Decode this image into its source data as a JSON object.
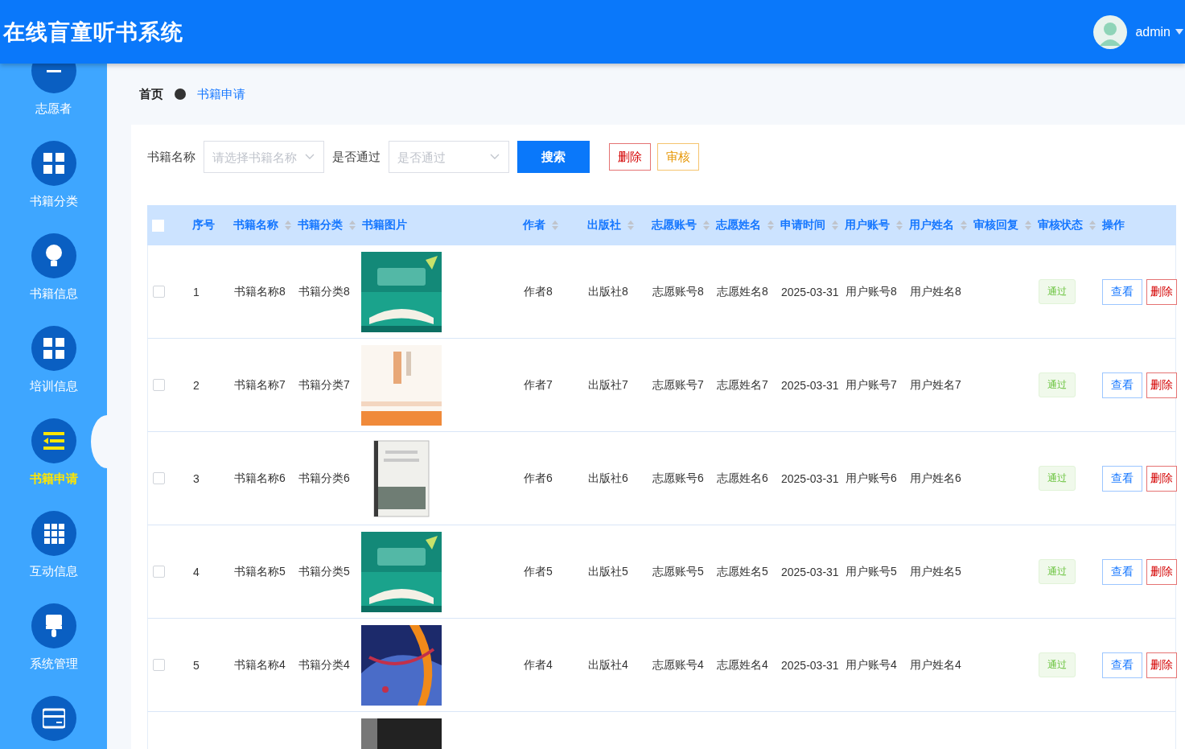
{
  "header": {
    "title": "在线盲童听书系统",
    "user": "admin"
  },
  "sidebar": {
    "items": [
      {
        "label": "志愿者",
        "kind": "minus",
        "selected": false
      },
      {
        "label": "书籍分类",
        "kind": "grid",
        "selected": false
      },
      {
        "label": "书籍信息",
        "kind": "bulb",
        "selected": false
      },
      {
        "label": "培训信息",
        "kind": "grid",
        "selected": false
      },
      {
        "label": "书籍申请",
        "kind": "list",
        "selected": true
      },
      {
        "label": "互动信息",
        "kind": "grid9",
        "selected": false
      },
      {
        "label": "系统管理",
        "kind": "brush",
        "selected": false
      },
      {
        "kind": "card",
        "selected": false
      }
    ]
  },
  "breadcrumb": [
    {
      "label": "首页",
      "current": false
    },
    {
      "label": "书籍申请",
      "current": true
    }
  ],
  "search": {
    "fields": [
      {
        "label": "书籍名称",
        "placeholder": "请选择书籍名称"
      },
      {
        "label": "是否通过",
        "placeholder": "是否通过"
      }
    ],
    "buttons": [
      {
        "label": "搜索",
        "kind": "primary"
      },
      {
        "label": "删除",
        "kind": "danger"
      },
      {
        "label": "审核",
        "kind": "warning"
      }
    ]
  },
  "table": {
    "all_checked": false,
    "columns": [
      {
        "label": "序号",
        "sortable": false
      },
      {
        "label": "书籍名称",
        "sortable": true
      },
      {
        "label": "书籍分类",
        "sortable": true
      },
      {
        "label": "书籍图片",
        "sortable": false
      },
      {
        "label": "作者",
        "sortable": true
      },
      {
        "label": "出版社",
        "sortable": true
      },
      {
        "label": "志愿账号",
        "sortable": true
      },
      {
        "label": "志愿姓名",
        "sortable": true
      },
      {
        "label": "申请时间",
        "sortable": true
      },
      {
        "label": "用户账号",
        "sortable": true
      },
      {
        "label": "用户姓名",
        "sortable": true
      },
      {
        "label": "审核回复",
        "sortable": true
      },
      {
        "label": "审核状态",
        "sortable": true
      },
      {
        "label": "操作",
        "sortable": false
      }
    ],
    "rows": [
      {
        "checked": false,
        "cells": [
          "1",
          "书籍名称8",
          "书籍分类8",
          {
            "kind": "picture"
          },
          "作者8",
          "出版社8",
          "志愿账号8",
          "志愿姓名8",
          "2025-03-31",
          "用户账号8",
          "用户姓名8",
          "",
          {
            "kind": "status",
            "text": "通过"
          },
          {
            "kind": "actions",
            "buttons": [
              "查看",
              "删除"
            ]
          }
        ]
      },
      {
        "checked": false,
        "cells": [
          "2",
          "书籍名称7",
          "书籍分类7",
          {
            "kind": "picture"
          },
          "作者7",
          "出版社7",
          "志愿账号7",
          "志愿姓名7",
          "2025-03-31",
          "用户账号7",
          "用户姓名7",
          "",
          {
            "kind": "status",
            "text": "通过"
          },
          {
            "kind": "actions",
            "buttons": [
              "查看",
              "删除"
            ]
          }
        ]
      },
      {
        "checked": false,
        "cells": [
          "3",
          "书籍名称6",
          "书籍分类6",
          {
            "kind": "picture"
          },
          "作者6",
          "出版社6",
          "志愿账号6",
          "志愿姓名6",
          "2025-03-31",
          "用户账号6",
          "用户姓名6",
          "",
          {
            "kind": "status",
            "text": "通过"
          },
          {
            "kind": "actions",
            "buttons": [
              "查看",
              "删除"
            ]
          }
        ]
      },
      {
        "checked": false,
        "cells": [
          "4",
          "书籍名称5",
          "书籍分类5",
          {
            "kind": "picture"
          },
          "作者5",
          "出版社5",
          "志愿账号5",
          "志愿姓名5",
          "2025-03-31",
          "用户账号5",
          "用户姓名5",
          "",
          {
            "kind": "status",
            "text": "通过"
          },
          {
            "kind": "actions",
            "buttons": [
              "查看",
              "删除"
            ]
          }
        ]
      },
      {
        "checked": false,
        "cells": [
          "5",
          "书籍名称4",
          "书籍分类4",
          {
            "kind": "picture"
          },
          "作者4",
          "出版社4",
          "志愿账号4",
          "志愿姓名4",
          "2025-03-31",
          "用户账号4",
          "用户姓名4",
          "",
          {
            "kind": "status",
            "text": "通过"
          },
          {
            "kind": "actions",
            "buttons": [
              "查看",
              "删除"
            ]
          }
        ]
      },
      {
        "cells": [
          "",
          "",
          "",
          {
            "kind": "picture"
          }
        ]
      }
    ]
  }
}
